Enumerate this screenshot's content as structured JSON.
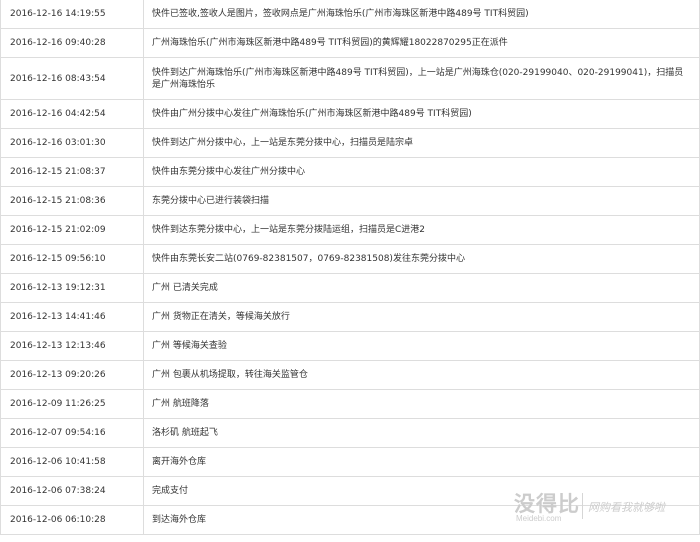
{
  "tracking": {
    "rows": [
      {
        "time": "2016-12-16 14:19:55",
        "desc": "快件已签收,签收人是图片，签收网点是广州海珠怡乐(广州市海珠区新港中路489号 TIT科贸园)"
      },
      {
        "time": "2016-12-16 09:40:28",
        "desc": "广州海珠怡乐(广州市海珠区新港中路489号 TIT科贸园)的黄辉耀18022870295正在派件"
      },
      {
        "time": "2016-12-16 08:43:54",
        "desc": "快件到达广州海珠怡乐(广州市海珠区新港中路489号 TIT科贸园)，上一站是广州海珠仓(020-29199040、020-29199041)，扫描员是广州海珠怡乐"
      },
      {
        "time": "2016-12-16 04:42:54",
        "desc": "快件由广州分拨中心发往广州海珠怡乐(广州市海珠区新港中路489号 TIT科贸园)"
      },
      {
        "time": "2016-12-16 03:01:30",
        "desc": "快件到达广州分拨中心，上一站是东莞分拨中心，扫描员是陆宗卓"
      },
      {
        "time": "2016-12-15 21:08:37",
        "desc": "快件由东莞分拨中心发往广州分拨中心"
      },
      {
        "time": "2016-12-15 21:08:36",
        "desc": "东莞分拨中心已进行装袋扫描"
      },
      {
        "time": "2016-12-15 21:02:09",
        "desc": "快件到达东莞分拨中心，上一站是东莞分拨陆运组，扫描员是C进港2"
      },
      {
        "time": "2016-12-15 09:56:10",
        "desc": "快件由东莞长安二站(0769-82381507，0769-82381508)发往东莞分拨中心"
      },
      {
        "time": "2016-12-13 19:12:31",
        "desc": "广州 已清关完成"
      },
      {
        "time": "2016-12-13 14:41:46",
        "desc": "广州 货物正在清关，等候海关放行"
      },
      {
        "time": "2016-12-13 12:13:46",
        "desc": "广州 等候海关查验"
      },
      {
        "time": "2016-12-13 09:20:26",
        "desc": "广州 包裹从机场提取，转往海关监管仓"
      },
      {
        "time": "2016-12-09 11:26:25",
        "desc": "广州 航班降落"
      },
      {
        "time": "2016-12-07 09:54:16",
        "desc": "洛杉矶 航班起飞"
      },
      {
        "time": "2016-12-06 10:41:58",
        "desc": "离开海外仓库"
      },
      {
        "time": "2016-12-06 07:38:24",
        "desc": "完成支付"
      },
      {
        "time": "2016-12-06 06:10:28",
        "desc": "到达海外仓库"
      }
    ]
  },
  "watermark": {
    "brand": "没得比",
    "domain": "Meidebi.com",
    "slogan": "网购看我就够啦"
  }
}
